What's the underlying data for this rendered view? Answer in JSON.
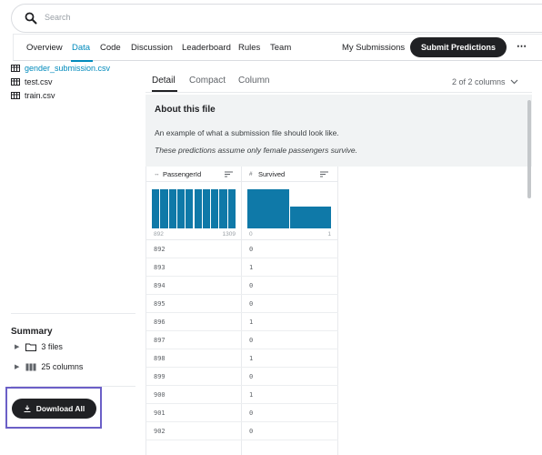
{
  "search": {
    "placeholder": "Search"
  },
  "nav": {
    "tabs": [
      "Overview",
      "Data",
      "Code",
      "Discussion",
      "Leaderboard",
      "Rules",
      "Team"
    ],
    "active_tab": "Data",
    "my_submissions": "My Submissions",
    "submit_label": "Submit Predictions",
    "more_label": "⋯"
  },
  "files": [
    {
      "name": "gender_submission.csv",
      "active": true
    },
    {
      "name": "test.csv",
      "active": false
    },
    {
      "name": "train.csv",
      "active": false
    }
  ],
  "summary": {
    "title": "Summary",
    "files_label": "3 files",
    "columns_label": "25 columns"
  },
  "download_label": "Download All",
  "viewer": {
    "tabs": [
      "Detail",
      "Compact",
      "Column"
    ],
    "active_tab": "Detail",
    "columns_selector": "2 of 2 columns"
  },
  "about": {
    "title": "About this file",
    "line1": "An example of what a submission file should look like.",
    "line2": "These predictions assume only female passengers survive."
  },
  "columns": [
    {
      "type_icon": "↔",
      "name": "PassengerId",
      "hist_min": "892",
      "hist_max": "1309",
      "hist_bins": [
        1,
        1,
        1,
        1,
        1,
        1,
        1,
        1,
        1,
        1
      ],
      "values": [
        "892",
        "893",
        "894",
        "895",
        "896",
        "897",
        "898",
        "899",
        "900",
        "901",
        "902"
      ]
    },
    {
      "type_icon": "#",
      "name": "Survived",
      "hist_min": "0",
      "hist_max": "1",
      "hist_bins": [
        1,
        0.55
      ],
      "values": [
        "0",
        "1",
        "0",
        "0",
        "1",
        "0",
        "1",
        "0",
        "1",
        "0",
        "0"
      ]
    }
  ],
  "colors": {
    "accent": "#008abc",
    "dark": "#202124",
    "bar": "#0f79a8",
    "highlight": "#6b5fc7"
  }
}
